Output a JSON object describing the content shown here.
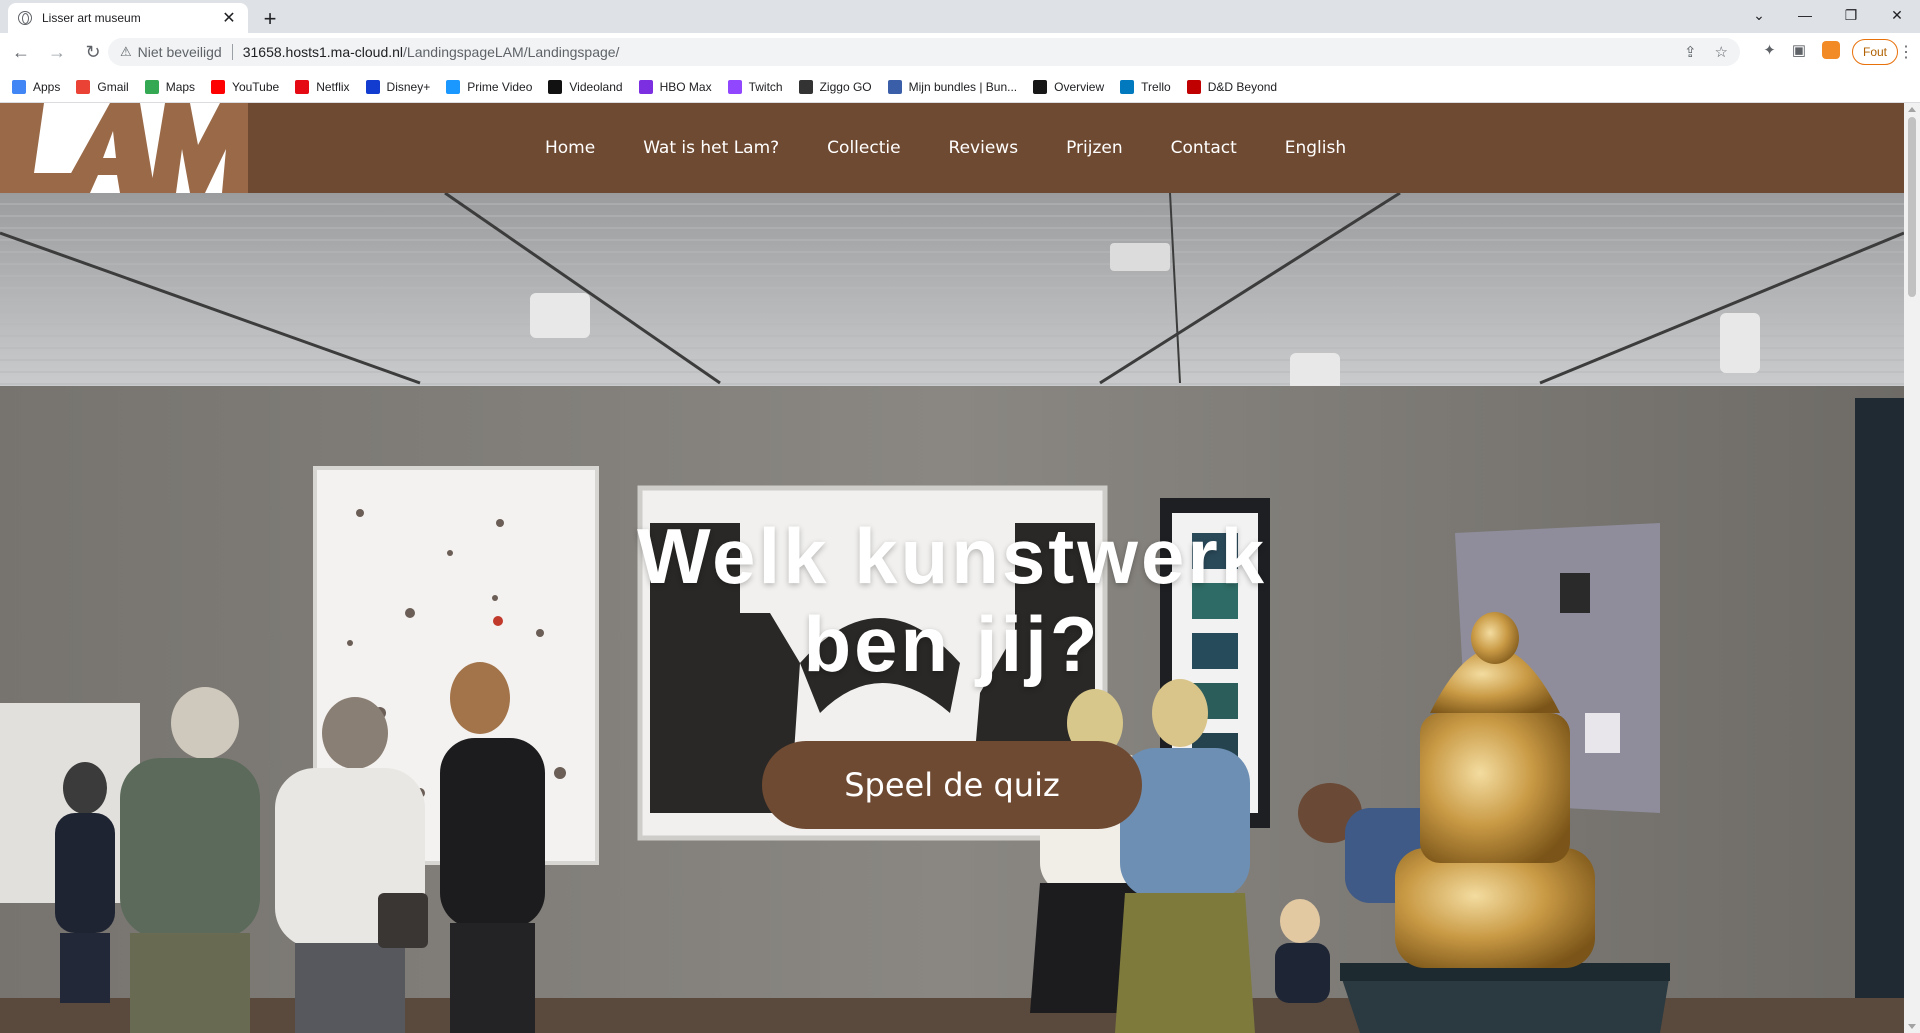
{
  "browser": {
    "tab_title": "Lisser art museum",
    "tab_close": "✕",
    "new_tab": "+",
    "window_controls": [
      "⌄",
      "—",
      "❐",
      "✕"
    ],
    "security_label": "Niet beveiligd",
    "url_host": "31658.hosts1.ma-cloud.nl",
    "url_path": "/LandingspageLAM/Landingspage/",
    "profile_button": "Fout",
    "bookmarks": [
      {
        "label": "Apps",
        "icon": "apps-grid-icon",
        "color": "#4285f4"
      },
      {
        "label": "Gmail",
        "icon": "gmail-icon",
        "color": "#ea4335"
      },
      {
        "label": "Maps",
        "icon": "maps-icon",
        "color": "#34a853"
      },
      {
        "label": "YouTube",
        "icon": "youtube-icon",
        "color": "#ff0000"
      },
      {
        "label": "Netflix",
        "icon": "netflix-icon",
        "color": "#e50914"
      },
      {
        "label": "Disney+",
        "icon": "disney-icon",
        "color": "#113ccf"
      },
      {
        "label": "Prime Video",
        "icon": "prime-video-icon",
        "color": "#1a98ff"
      },
      {
        "label": "Videoland",
        "icon": "videoland-icon",
        "color": "#111111"
      },
      {
        "label": "HBO Max",
        "icon": "hbo-max-icon",
        "color": "#7b2fe0"
      },
      {
        "label": "Twitch",
        "icon": "twitch-icon",
        "color": "#9146ff"
      },
      {
        "label": "Ziggo GO",
        "icon": "ziggo-go-icon",
        "color": "#333333"
      },
      {
        "label": "Mijn bundles | Bun...",
        "icon": "bundles-icon",
        "color": "#3a5fa8"
      },
      {
        "label": "Overview",
        "icon": "github-icon",
        "color": "#181717"
      },
      {
        "label": "Trello",
        "icon": "trello-icon",
        "color": "#0079bf"
      },
      {
        "label": "D&D Beyond",
        "icon": "dnd-beyond-icon",
        "color": "#c00000"
      }
    ]
  },
  "site": {
    "logo_text": "LAM",
    "nav": [
      "Home",
      "Wat is het Lam?",
      "Collectie",
      "Reviews",
      "Prijzen",
      "Contact",
      "English"
    ],
    "hero": {
      "title_line1": "Welk kunstwerk",
      "title_line2": "ben jij?",
      "cta": "Speel de quiz"
    },
    "colors": {
      "brand_brown": "#6f4a32",
      "logo_brown": "#9a6a48"
    }
  }
}
